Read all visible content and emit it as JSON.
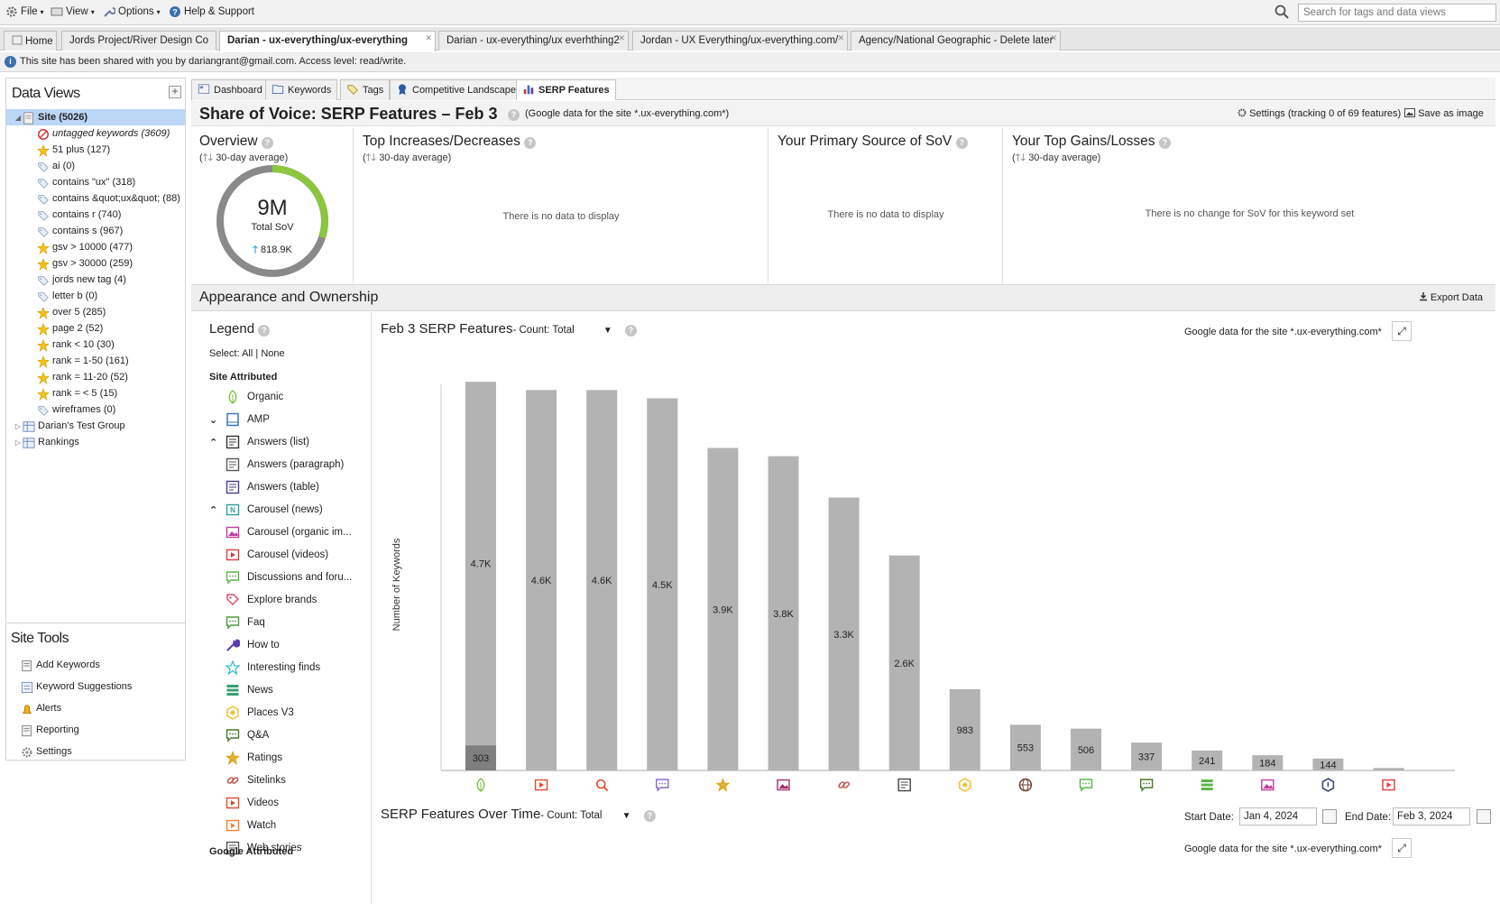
{
  "menu": {
    "file": "File",
    "view": "View",
    "options": "Options",
    "help": "Help & Support",
    "search_placeholder": "Search for tags and data views"
  },
  "tabs": [
    {
      "label": "Home",
      "closable": false,
      "active": false
    },
    {
      "label": "Jords Project/River Design Co",
      "closable": false,
      "active": false
    },
    {
      "label": "Darian - ux-everything/ux-everything",
      "closable": true,
      "active": true
    },
    {
      "label": "Darian - ux-everything/ux everhthing2",
      "closable": true,
      "active": false
    },
    {
      "label": "Jordan - UX Everything/ux-everything.com/",
      "closable": true,
      "active": false
    },
    {
      "label": "Agency/National Geographic - Delete later",
      "closable": true,
      "active": false
    }
  ],
  "shared_notice": "This site has been shared with you by dariangrant@gmail.com. Access level: read/write.",
  "sidebar": {
    "title": "Data Views",
    "tree": [
      {
        "label": "Site (5026)",
        "icon": "site-icon",
        "level": 0,
        "expanded": true,
        "selected": true
      },
      {
        "label": "untagged keywords (3609)",
        "icon": "no-tag-icon",
        "level": 1,
        "italic": true
      },
      {
        "label": "51 plus (127)",
        "icon": "star-icon",
        "level": 1
      },
      {
        "label": "ai (0)",
        "icon": "tag-icon",
        "level": 1
      },
      {
        "label": "contains \"ux\" (318)",
        "icon": "tag-icon",
        "level": 1
      },
      {
        "label": "contains &quot;ux&quot; (88)",
        "icon": "tag-icon",
        "level": 1
      },
      {
        "label": "contains r (740)",
        "icon": "tag-icon",
        "level": 1
      },
      {
        "label": "contains s (967)",
        "icon": "tag-icon",
        "level": 1
      },
      {
        "label": "gsv > 10000 (477)",
        "icon": "star-icon",
        "level": 1
      },
      {
        "label": "gsv > 30000 (259)",
        "icon": "star-icon",
        "level": 1
      },
      {
        "label": "jords new tag (4)",
        "icon": "tag-icon",
        "level": 1
      },
      {
        "label": "letter b (0)",
        "icon": "tag-icon",
        "level": 1
      },
      {
        "label": "over 5 (285)",
        "icon": "star-icon",
        "level": 1
      },
      {
        "label": "page 2 (52)",
        "icon": "star-icon",
        "level": 1
      },
      {
        "label": "rank < 10 (30)",
        "icon": "star-icon",
        "level": 1
      },
      {
        "label": "rank = 1-50 (161)",
        "icon": "star-icon",
        "level": 1
      },
      {
        "label": "rank = 11-20 (52)",
        "icon": "star-icon",
        "level": 1
      },
      {
        "label": "rank = < 5 (15)",
        "icon": "star-icon",
        "level": 1
      },
      {
        "label": "wireframes (0)",
        "icon": "tag-icon",
        "level": 1
      },
      {
        "label": "Darian's Test Group",
        "icon": "group-icon",
        "level": 0,
        "expanded": false
      },
      {
        "label": "Rankings",
        "icon": "group-icon",
        "level": 0,
        "expanded": false
      }
    ],
    "tools_title": "Site Tools",
    "tools": [
      {
        "label": "Add Keywords",
        "icon": "add-keywords-icon"
      },
      {
        "label": "Keyword Suggestions",
        "icon": "suggestions-icon"
      },
      {
        "label": "Alerts",
        "icon": "alerts-icon"
      },
      {
        "label": "Reporting",
        "icon": "reporting-icon"
      },
      {
        "label": "Settings",
        "icon": "gear-icon"
      }
    ]
  },
  "view_tabs": [
    {
      "label": "Dashboard",
      "icon": "dashboard-icon"
    },
    {
      "label": "Keywords",
      "icon": "keywords-icon"
    },
    {
      "label": "Tags",
      "icon": "tags-icon"
    },
    {
      "label": "Competitive Landscape",
      "icon": "landscape-icon"
    },
    {
      "label": "SERP Features",
      "icon": "bar-chart-icon",
      "active": true
    }
  ],
  "header": {
    "title": "Share of Voice: SERP Features",
    "date": "– Feb 3",
    "subtitle": "(Google data for the site *.ux-everything.com*)",
    "settings": "Settings (tracking 0 of 69 features)",
    "save_image": "Save as image"
  },
  "overview": {
    "title": "Overview",
    "subtitle": "30-day average)",
    "value": "9M",
    "value_label": "Total SoV",
    "change": "818.9K",
    "ring_fraction": 0.3,
    "ring_color": "#8cc63f",
    "ring_base_color": "#8a8a8a"
  },
  "panels": {
    "increases_title": "Top Increases/Decreases",
    "increases_sub": "30-day average)",
    "increases_empty": "There is no data to display",
    "source_title": "Your Primary Source of SoV",
    "source_empty": "There is no data to display",
    "gains_title": "Your Top Gains/Losses",
    "gains_sub": "30-day average)",
    "gains_empty": "There is no change for SoV for this keyword set"
  },
  "appearance": {
    "title": "Appearance and Ownership",
    "export": "Export Data"
  },
  "legend": {
    "title": "Legend",
    "select_label": "Select:",
    "select_all": "All",
    "select_none": "None",
    "group_site": "Site Attributed",
    "group_google": "Google Attributed",
    "items": [
      {
        "label": "Organic",
        "icon": "organic-icon",
        "color": "#7cc242",
        "chev": ""
      },
      {
        "label": "AMP",
        "icon": "amp-icon",
        "color": "#3a78c2",
        "chev": "down"
      },
      {
        "label": "Answers (list)",
        "icon": "answers-list-icon",
        "color": "#333333",
        "chev": "up"
      },
      {
        "label": "Answers (paragraph)",
        "icon": "answers-paragraph-icon",
        "color": "#555555",
        "chev": ""
      },
      {
        "label": "Answers (table)",
        "icon": "answers-table-icon",
        "color": "#4a3a8a",
        "chev": ""
      },
      {
        "label": "Carousel (news)",
        "icon": "carousel-news-icon",
        "color": "#2aa0a0",
        "chev": "up"
      },
      {
        "label": "Carousel (organic im...",
        "icon": "carousel-organic-icon",
        "color": "#c23aa0",
        "chev": ""
      },
      {
        "label": "Carousel (videos)",
        "icon": "carousel-videos-icon",
        "color": "#e03a3a",
        "chev": ""
      },
      {
        "label": "Discussions and foru...",
        "icon": "discussions-icon",
        "color": "#5ab84a",
        "chev": ""
      },
      {
        "label": "Explore brands",
        "icon": "explore-brands-icon",
        "color": "#e0506a",
        "chev": ""
      },
      {
        "label": "Faq",
        "icon": "faq-icon",
        "color": "#4a9a3a",
        "chev": ""
      },
      {
        "label": "How to",
        "icon": "how-to-icon",
        "color": "#5a3ab0",
        "chev": ""
      },
      {
        "label": "Interesting finds",
        "icon": "interesting-finds-icon",
        "color": "#3ac0d0",
        "chev": ""
      },
      {
        "label": "News",
        "icon": "news-icon",
        "color": "#3aa070",
        "chev": ""
      },
      {
        "label": "Places V3",
        "icon": "places-icon",
        "color": "#f0c030",
        "chev": ""
      },
      {
        "label": "Q&A",
        "icon": "qa-icon",
        "color": "#4a7a2a",
        "chev": ""
      },
      {
        "label": "Ratings",
        "icon": "ratings-icon",
        "color": "#e0b030",
        "chev": ""
      },
      {
        "label": "Sitelinks",
        "icon": "sitelinks-icon",
        "color": "#c0504a",
        "chev": ""
      },
      {
        "label": "Videos",
        "icon": "videos-icon",
        "color": "#e04a2a",
        "chev": ""
      },
      {
        "label": "Watch",
        "icon": "watch-icon",
        "color": "#f08030",
        "chev": ""
      },
      {
        "label": "Web stories",
        "icon": "web-stories-icon",
        "color": "#555555",
        "chev": ""
      }
    ]
  },
  "chart_header": {
    "title": "Feb 3 SERP Features",
    "count": "- Count: Total",
    "source": "Google data for the site *.ux-everything.com*"
  },
  "chart_data": {
    "type": "bar",
    "title": "Feb 3 SERP Features",
    "ylabel": "Number of Keywords",
    "xlabel": "",
    "ylim": [
      0,
      4800
    ],
    "grid": false,
    "values": [
      4700,
      4600,
      4600,
      4500,
      3900,
      3800,
      3300,
      2600,
      983,
      553,
      506,
      337,
      241,
      184,
      144,
      30
    ],
    "labels": [
      "4.7K",
      "4.6K",
      "4.6K",
      "4.5K",
      "3.9K",
      "3.8K",
      "3.3K",
      "2.6K",
      "983",
      "553",
      "506",
      "337",
      "241",
      "184",
      "144",
      ""
    ],
    "owned_values": [
      303,
      0,
      0,
      0,
      0,
      0,
      0,
      0,
      0,
      0,
      0,
      0,
      0,
      0,
      0,
      0
    ],
    "owned_labels": [
      "303",
      "",
      "",
      "",
      "",
      "",
      "",
      "",
      "",
      "",
      "",
      "",
      "",
      "",
      "",
      ""
    ],
    "category_icons": [
      "organic-icon",
      "videos-icon",
      "search-icon",
      "discussions-icon",
      "ratings-icon",
      "image-icon",
      "sitelinks-icon",
      "answers-paragraph-icon",
      "places-icon",
      "globe-icon",
      "discussions-icon",
      "qa-icon",
      "list-icon",
      "carousel-organic-icon",
      "knowledge-icon",
      "carousel-videos-icon"
    ],
    "category_colors": [
      "#7cc242",
      "#e04a2a",
      "#e04a2a",
      "#8a6ad0",
      "#e0b030",
      "#a0306a",
      "#c0504a",
      "#444444",
      "#f0c030",
      "#704030",
      "#5ab84a",
      "#4a7a2a",
      "#5ab84a",
      "#c23aa0",
      "#3a4a7a",
      "#e03a3a"
    ],
    "bar_color": "#b3b3b3",
    "owned_color": "#7f7f7f"
  },
  "over_time": {
    "title": "SERP Features Over Time",
    "count": "- Count: Total",
    "start_label": "Start Date:",
    "start_value": "Jan 4, 2024",
    "end_label": "End Date:",
    "end_value": "Feb 3, 2024",
    "source": "Google data for the site *.ux-everything.com*"
  }
}
